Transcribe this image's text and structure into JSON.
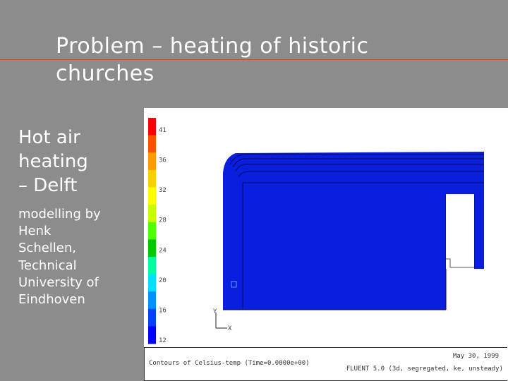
{
  "slide": {
    "title_lines": [
      "Problem – heating of historic",
      "churches"
    ],
    "subheading_lines": [
      "Hot air",
      "heating",
      "– Delft"
    ],
    "body_lines": [
      "modelling by",
      "Henk",
      "Schellen,",
      "Technical",
      "University of",
      "Eindhoven"
    ],
    "accent_line_color": "#c84a3c",
    "background_color": "#8c8c8c"
  },
  "figure": {
    "legend_values": [
      "41",
      "36",
      "32",
      "28",
      "24",
      "20",
      "16",
      "12"
    ],
    "legend_colors": [
      "#ff0000",
      "#ff5000",
      "#ff9a00",
      "#ffd000",
      "#ffff00",
      "#c8ff00",
      "#50ff00",
      "#00c800",
      "#00ffa0",
      "#00e0ff",
      "#0090ff",
      "#0040ff",
      "#0000ff"
    ],
    "axis_y_label": "Y",
    "axis_x_label": "X",
    "fill_color": "#0a1ee0",
    "caption_left": "Contours of Celsius-temp (Time=0.0000e+00)",
    "caption_date": "May 30, 1999",
    "caption_solver": "FLUENT 5.0 (3d, segregated, ke, unsteady)"
  }
}
